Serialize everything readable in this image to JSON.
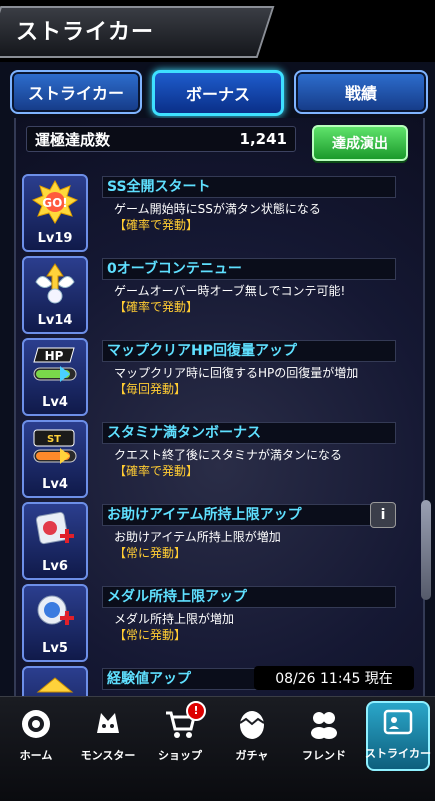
{
  "header": {
    "title": "ストライカー"
  },
  "tabs": [
    {
      "label": "ストライカー",
      "active": false
    },
    {
      "label": "ボーナス",
      "active": true
    },
    {
      "label": "戦績",
      "active": false
    }
  ],
  "summary": {
    "label": "運極達成数",
    "value": "1,241",
    "button": "達成演出"
  },
  "items": [
    {
      "icon": "go-badge-icon",
      "level": "Lv19",
      "name": "SS全開スタート",
      "desc": "ゲーム開始時にSSが満タン状態になる",
      "cond": "【確率で発動】"
    },
    {
      "icon": "winged-orb-icon",
      "level": "Lv14",
      "name": "0オーブコンテニュー",
      "desc": "ゲームオーバー時オーブ無しでコンテ可能!",
      "cond": "【確率で発動】"
    },
    {
      "icon": "hp-bar-icon",
      "level": "Lv4",
      "name": "マップクリアHP回復量アップ",
      "desc": "マップクリア時に回復するHPの回復量が増加",
      "cond": "【毎回発動】"
    },
    {
      "icon": "stamina-icon",
      "level": "Lv4",
      "name": "スタミナ満タンボーナス",
      "desc": "クエスト終了後にスタミナが満タンになる",
      "cond": "【確率で発動】"
    },
    {
      "icon": "item-box-icon",
      "level": "Lv6",
      "name": "お助けアイテム所持上限アップ",
      "desc": "お助けアイテム所持上限が増加",
      "cond": "【常に発動】"
    },
    {
      "icon": "medal-plus-icon",
      "level": "Lv5",
      "name": "メダル所持上限アップ",
      "desc": "メダル所持上限が増加",
      "cond": "【常に発動】"
    },
    {
      "icon": "exp-up-icon",
      "level": "",
      "name": "経験値アップ",
      "desc": "",
      "cond": ""
    }
  ],
  "timestamp": "08/26 11:45 現在",
  "nav": [
    {
      "label": "ホーム",
      "icon": "home-icon"
    },
    {
      "label": "モンスター",
      "icon": "monster-icon"
    },
    {
      "label": "ショップ",
      "icon": "cart-icon",
      "badge": "!"
    },
    {
      "label": "ガチャ",
      "icon": "gacha-egg-icon"
    },
    {
      "label": "フレンド",
      "icon": "friends-icon"
    },
    {
      "label": "ストライカー",
      "icon": "striker-card-icon",
      "active": true
    }
  ],
  "colors": {
    "accent": "#3ee0ff",
    "name_text": "#5fe0ff",
    "condition_text": "#ffcc33",
    "achievement_button": "#2fbf3e"
  }
}
